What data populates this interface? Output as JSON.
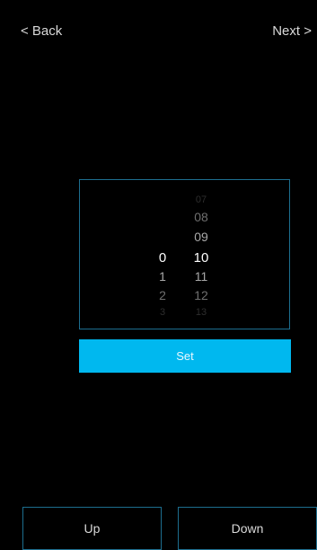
{
  "nav": {
    "back_label": "< Back",
    "next_label": "Next >"
  },
  "picker": {
    "left_column": [
      "0",
      "1",
      "2",
      "3"
    ],
    "right_column": [
      "07",
      "08",
      "09",
      "10",
      "11",
      "12",
      "13"
    ]
  },
  "set_button": {
    "label": "Set"
  },
  "bottom": {
    "up_label": "Up",
    "down_label": "Down"
  },
  "colors": {
    "background": "#000000",
    "accent": "#00b8ef",
    "border": "#1d6e8f"
  }
}
